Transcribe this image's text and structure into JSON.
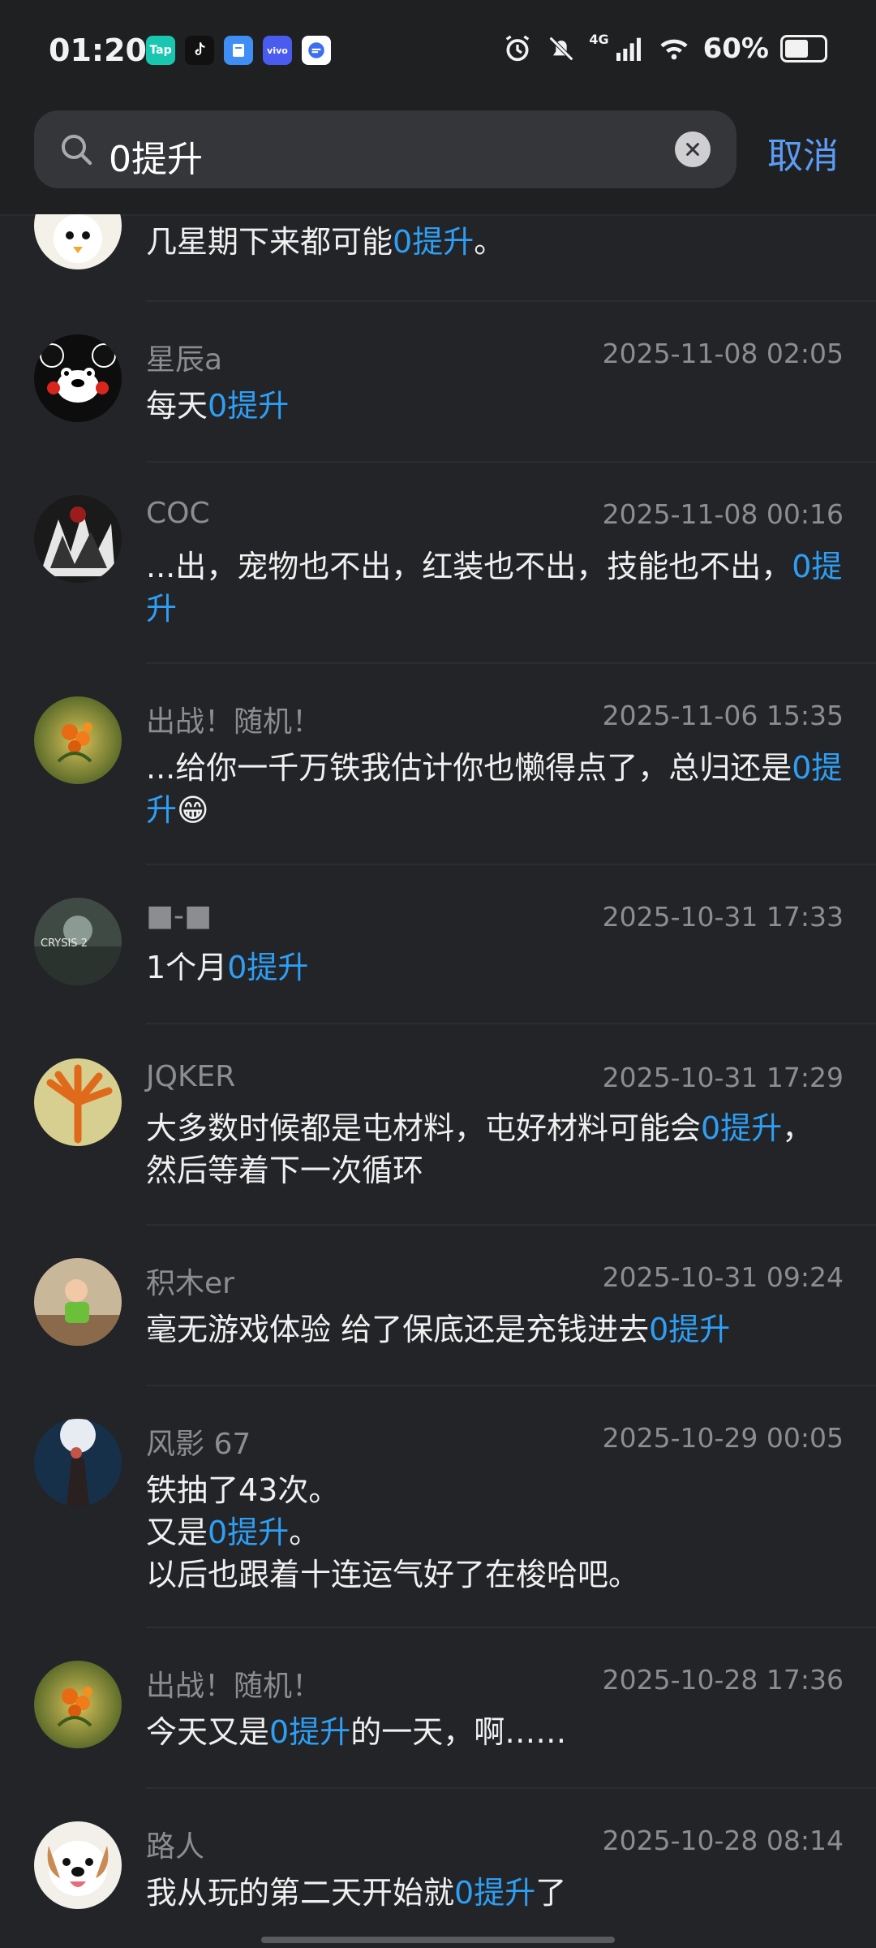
{
  "status": {
    "time": "01:20",
    "network": "4G",
    "battery": "60%",
    "battery_level": 0.6,
    "app_icons": [
      "Tap",
      "TikTok",
      "Files",
      "vivo",
      "Browser"
    ]
  },
  "search": {
    "query": "0提升",
    "cancel_label": "取消"
  },
  "colors": {
    "highlight": "#2e9ff5",
    "accent": "#5d9cf5",
    "background": "#232427"
  },
  "comments": [
    {
      "name": "",
      "time": "",
      "pre": "几星期下来都可能",
      "hl": "0提升",
      "post": "。",
      "avatar": "rooster-avatar"
    },
    {
      "name": "星辰a",
      "time": "2025-11-08 02:05",
      "pre": "每天",
      "hl": "0提升",
      "post": "",
      "avatar": "bear-avatar"
    },
    {
      "name": "COC",
      "time": "2025-11-08 00:16",
      "pre": "...出，宠物也不出，红装也不出，技能也不出，",
      "hl": "0提升",
      "post": "",
      "avatar": "dark-art-avatar"
    },
    {
      "name": "出战！随机！",
      "time": "2025-11-06 15:35",
      "pre": "...给你一千万铁我估计你也懒得点了，总归还是",
      "hl": "0提升",
      "post": "😁",
      "avatar": "flower-avatar"
    },
    {
      "name": "■-■",
      "time": "2025-10-31 17:33",
      "pre": "1个月",
      "hl": "0提升",
      "post": "",
      "avatar": "crysis-avatar"
    },
    {
      "name": "JQKER",
      "time": "2025-10-31 17:29",
      "pre": "大多数时候都是屯材料，屯好材料可能会",
      "hl": "0提升",
      "post": "，然后等着下一次循环",
      "avatar": "leaf-avatar"
    },
    {
      "name": "积木er",
      "time": "2025-10-31 09:24",
      "pre": "毫无游戏体验 给了保底还是充钱进去",
      "hl": "0提升",
      "post": "",
      "avatar": "child-avatar"
    },
    {
      "name": "风影 67",
      "time": "2025-10-29 00:05",
      "pre": "铁抽了43次。\n又是",
      "hl": "0提升",
      "post": "。\n以后也跟着十连运气好了在梭哈吧。",
      "avatar": "couple-avatar"
    },
    {
      "name": "出战！随机！",
      "time": "2025-10-28 17:36",
      "pre": "今天又是",
      "hl": "0提升",
      "post": "的一天，啊……",
      "avatar": "flower-avatar"
    },
    {
      "name": "路人",
      "time": "2025-10-28 08:14",
      "pre": "我从玩的第二天开始就",
      "hl": "0提升",
      "post": "了",
      "avatar": "dog-avatar"
    }
  ]
}
